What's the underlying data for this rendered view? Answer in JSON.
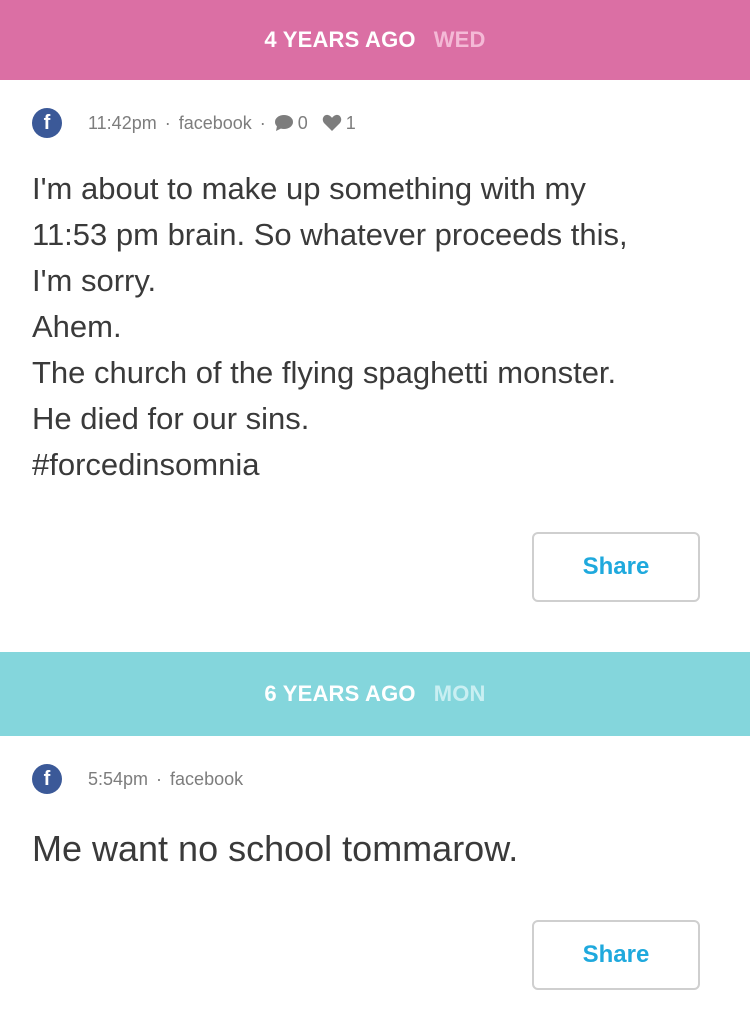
{
  "sections": [
    {
      "ago": "4 YEARS AGO",
      "day": "WED",
      "post": {
        "source_icon": "facebook-icon",
        "time": "11:42pm",
        "source": "facebook",
        "comments": "0",
        "likes": "1",
        "lines": [
          "I'm about to make up something with my",
          "11:53 pm brain. So whatever proceeds this,",
          "I'm sorry.",
          "Ahem.",
          "The church of the flying spaghetti monster.",
          "He died for our sins.",
          "#forcedinsomnia"
        ],
        "share_label": "Share"
      }
    },
    {
      "ago": "6 YEARS AGO",
      "day": "MON",
      "post": {
        "source_icon": "facebook-icon",
        "time": "5:54pm",
        "source": "facebook",
        "lines": [
          "Me want no school tommarow."
        ],
        "share_label": "Share"
      }
    }
  ],
  "colors": {
    "header_pink": "#db6fa4",
    "header_teal": "#84d6dc",
    "facebook_blue": "#3b5998",
    "share_blue": "#1fa9dd"
  },
  "separators": {
    "dot": "·"
  }
}
